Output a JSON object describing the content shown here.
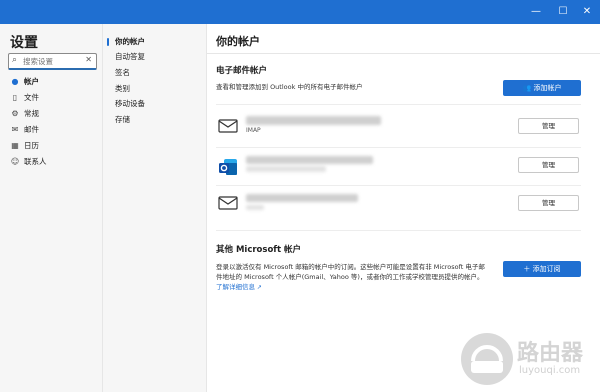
{
  "window": {
    "minimize": "—",
    "maximize": "☐",
    "close": "✕"
  },
  "sidebar": {
    "title": "设置",
    "search_placeholder": "搜索设置",
    "items": [
      {
        "label": "帐户",
        "icon": "person-icon"
      },
      {
        "label": "文件",
        "icon": "document-icon"
      },
      {
        "label": "常规",
        "icon": "gear-icon"
      },
      {
        "label": "邮件",
        "icon": "mail-icon"
      },
      {
        "label": "日历",
        "icon": "calendar-icon"
      },
      {
        "label": "联系人",
        "icon": "people-icon"
      }
    ]
  },
  "subnav": {
    "items": [
      "你的帐户",
      "自动答复",
      "签名",
      "类别",
      "移动设备",
      "存储"
    ]
  },
  "main": {
    "title": "你的帐户",
    "email_section": {
      "title": "电子邮件帐户",
      "description": "查看和管理添加到 Outlook 中的所有电子邮件帐户",
      "add_button": "添加帐户",
      "accounts": [
        {
          "icon": "mail-icon",
          "sub": "IMAP",
          "manage": "管理"
        },
        {
          "icon": "outlook-icon",
          "sub": "",
          "manage": "管理"
        },
        {
          "icon": "mail-icon",
          "sub": "",
          "manage": "管理"
        }
      ]
    },
    "other_section": {
      "title": "其他 Microsoft 帐户",
      "description": "登录以激活仅有 Microsoft 邮箱的帐户中的订阅。这些帐户可能是设置有非 Microsoft 电子邮件地址的 Microsoft 个人帐户(Gmail、Yahoo 等)，或者你的工作或学校管理员提供的帐户。",
      "link": "了解详细信息",
      "add_button": "添加订阅"
    }
  },
  "watermark": {
    "title": "路由器",
    "url": "luyouqi.com"
  }
}
